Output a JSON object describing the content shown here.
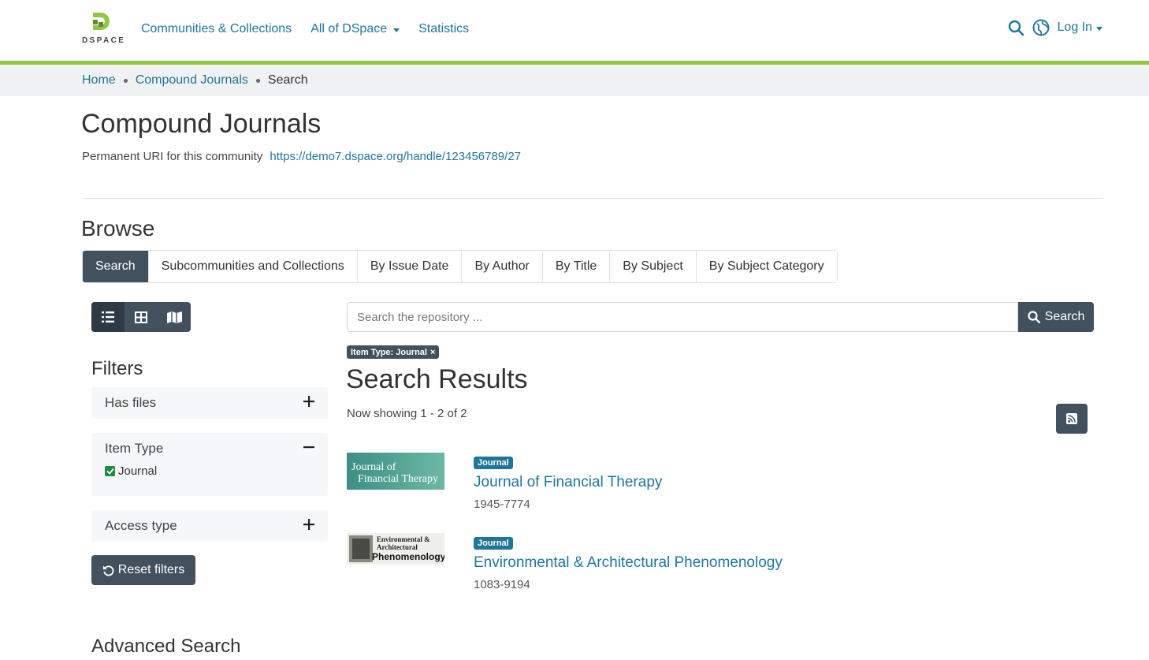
{
  "header": {
    "logo_text": "DSPACE",
    "nav": [
      {
        "label": "Communities & Collections"
      },
      {
        "label": "All of DSpace"
      },
      {
        "label": "Statistics"
      }
    ],
    "login_label": "Log In",
    "icons": [
      "search-icon",
      "globe-icon"
    ],
    "accent_color": "#92c642"
  },
  "breadcrumb": {
    "items": [
      "Home",
      "Compound Journals",
      "Search"
    ]
  },
  "page": {
    "title": "Compound Journals",
    "uri_label": "Permanent URI for this community",
    "uri": "https://demo7.dspace.org/handle/123456789/27"
  },
  "browse": {
    "title": "Browse",
    "tabs": [
      "Search",
      "Subcommunities and Collections",
      "By Issue Date",
      "By Author",
      "By Title",
      "By Subject",
      "By Subject Category"
    ],
    "active_tab": "Search"
  },
  "view_modes": [
    "list-icon",
    "grid-icon",
    "map-icon"
  ],
  "filters": {
    "title": "Filters",
    "facets": [
      {
        "label": "Has files",
        "toggle": "+"
      },
      {
        "label": "Item Type",
        "toggle": "−",
        "options": [
          {
            "label": "Journal",
            "checked": true
          }
        ]
      },
      {
        "label": "Access type",
        "toggle": "+"
      }
    ],
    "reset_label": "Reset filters"
  },
  "advanced_search_title": "Advanced Search",
  "search": {
    "placeholder": "Search the repository ...",
    "button_label": "Search",
    "active_filter": "Item Type: Journal",
    "results_title": "Search Results",
    "showing": "Now showing 1 - 2 of 2"
  },
  "results": [
    {
      "badge": "Journal",
      "title": "Journal of Financial Therapy",
      "issn": "1945-7774",
      "thumb_lines": [
        "Journal of",
        "Financial Therapy"
      ]
    },
    {
      "badge": "Journal",
      "title": "Environmental & Architectural Phenomenology",
      "issn": "1083-9194",
      "thumb_lines": [
        "Environmental &",
        "Architectural",
        "Phenomenology"
      ]
    }
  ],
  "colors": {
    "link": "#207698",
    "dark_button": "#43515f",
    "success": "#1f8c42"
  }
}
